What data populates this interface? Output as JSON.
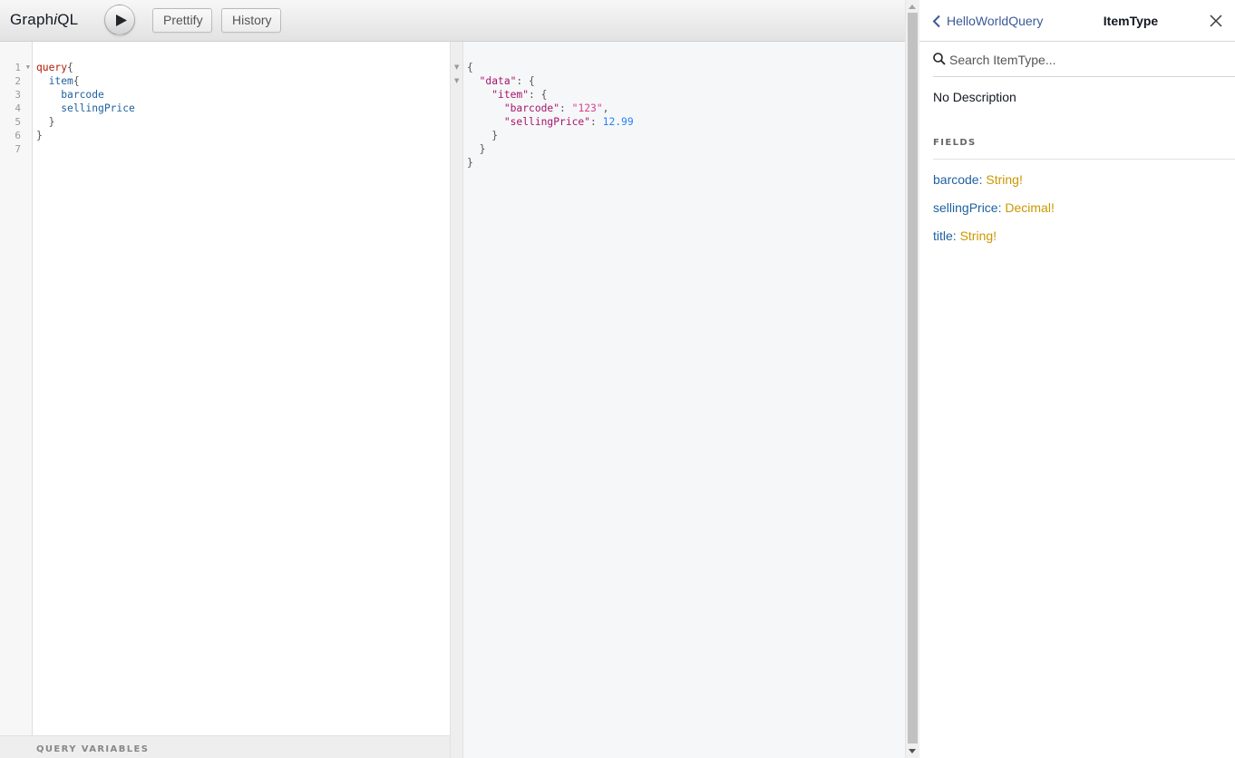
{
  "topbar": {
    "logo_prefix": "Graph",
    "logo_italic": "i",
    "logo_suffix": "QL",
    "prettify_label": "Prettify",
    "history_label": "History"
  },
  "query_editor": {
    "line_numbers": [
      "1",
      "2",
      "3",
      "4",
      "5",
      "6",
      "7"
    ],
    "lines": [
      [
        {
          "t": "query",
          "c": "kw"
        },
        {
          "t": "{",
          "c": "punc"
        }
      ],
      [
        {
          "t": "  ",
          "c": "punc"
        },
        {
          "t": "item",
          "c": "fld"
        },
        {
          "t": "{",
          "c": "punc"
        }
      ],
      [
        {
          "t": "    ",
          "c": "punc"
        },
        {
          "t": "barcode",
          "c": "fld"
        }
      ],
      [
        {
          "t": "    ",
          "c": "punc"
        },
        {
          "t": "sellingPrice",
          "c": "fld"
        }
      ],
      [
        {
          "t": "  }",
          "c": "punc"
        }
      ],
      [
        {
          "t": "}",
          "c": "punc"
        }
      ],
      []
    ],
    "variables_label": "QUERY VARIABLES"
  },
  "result": {
    "lines": [
      [
        {
          "t": "{",
          "c": "punc"
        }
      ],
      [
        {
          "t": "  ",
          "c": "punc"
        },
        {
          "t": "\"data\"",
          "c": "jkey"
        },
        {
          "t": ": {",
          "c": "punc"
        }
      ],
      [
        {
          "t": "    ",
          "c": "punc"
        },
        {
          "t": "\"item\"",
          "c": "jkey"
        },
        {
          "t": ": {",
          "c": "punc"
        }
      ],
      [
        {
          "t": "      ",
          "c": "punc"
        },
        {
          "t": "\"barcode\"",
          "c": "jkey"
        },
        {
          "t": ": ",
          "c": "punc"
        },
        {
          "t": "\"123\"",
          "c": "jstr"
        },
        {
          "t": ",",
          "c": "punc"
        }
      ],
      [
        {
          "t": "      ",
          "c": "punc"
        },
        {
          "t": "\"sellingPrice\"",
          "c": "jkey"
        },
        {
          "t": ": ",
          "c": "punc"
        },
        {
          "t": "12.99",
          "c": "jnum"
        }
      ],
      [
        {
          "t": "    }",
          "c": "punc"
        }
      ],
      [
        {
          "t": "  }",
          "c": "punc"
        }
      ],
      [
        {
          "t": "}",
          "c": "punc"
        }
      ]
    ]
  },
  "docs": {
    "back_label": "HelloWorldQuery",
    "title": "ItemType",
    "search_placeholder": "Search ItemType...",
    "description": "No Description",
    "fields_heading": "FIELDS",
    "fields": [
      {
        "name": "barcode",
        "type": "String",
        "non_null": "!"
      },
      {
        "name": "sellingPrice",
        "type": "Decimal",
        "non_null": "!"
      },
      {
        "name": "title",
        "type": "String",
        "non_null": "!"
      }
    ]
  },
  "icons": {
    "run": "play-icon",
    "back": "chevron-left-icon",
    "close": "close-icon",
    "search": "search-icon",
    "fold": "fold-arrow-icon"
  },
  "colors": {
    "keyword": "#b11a04",
    "field": "#1f61a0",
    "type": "#ca9800",
    "link": "#3b5998",
    "json_key": "#a4166d",
    "json_string": "#d64292",
    "json_number": "#2882f9"
  }
}
